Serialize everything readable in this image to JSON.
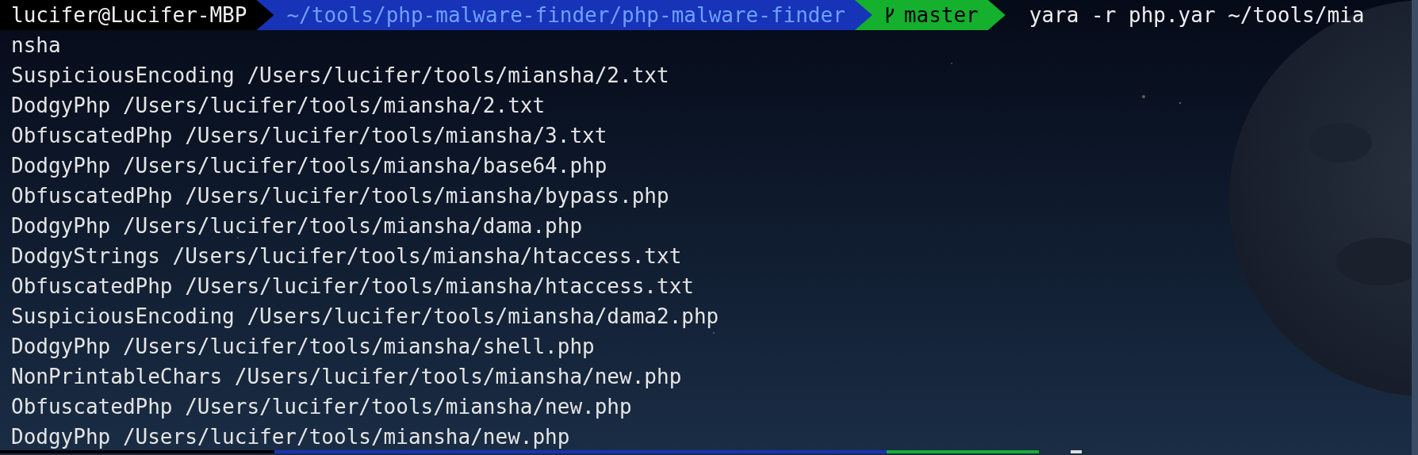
{
  "prompt": {
    "user_host": "lucifer@Lucifer-MBP",
    "path": "~/tools/php-malware-finder/php-malware-finder",
    "branch": "master",
    "command": "yara -r php.yar ~/tools/mia",
    "command_wrap": "nsha"
  },
  "output": [
    "SuspiciousEncoding /Users/lucifer/tools/miansha/2.txt",
    "DodgyPhp /Users/lucifer/tools/miansha/2.txt",
    "ObfuscatedPhp /Users/lucifer/tools/miansha/3.txt",
    "DodgyPhp /Users/lucifer/tools/miansha/base64.php",
    "ObfuscatedPhp /Users/lucifer/tools/miansha/bypass.php",
    "DodgyPhp /Users/lucifer/tools/miansha/dama.php",
    "DodgyStrings /Users/lucifer/tools/miansha/htaccess.txt",
    "ObfuscatedPhp /Users/lucifer/tools/miansha/htaccess.txt",
    "SuspiciousEncoding /Users/lucifer/tools/miansha/dama2.php",
    "DodgyPhp /Users/lucifer/tools/miansha/shell.php",
    "NonPrintableChars /Users/lucifer/tools/miansha/new.php",
    "ObfuscatedPhp /Users/lucifer/tools/miansha/new.php",
    "DodgyPhp /Users/lucifer/tools/miansha/new.php"
  ]
}
